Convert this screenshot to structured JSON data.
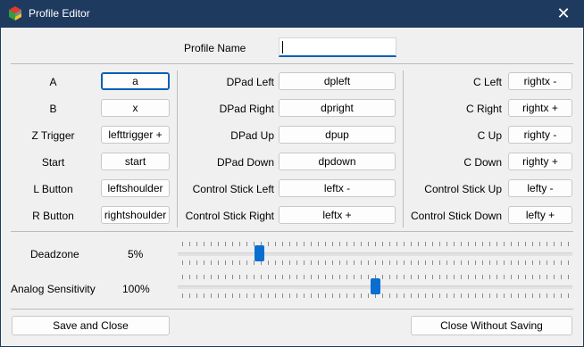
{
  "window": {
    "title": "Profile Editor"
  },
  "profile": {
    "label": "Profile Name",
    "value": ""
  },
  "col1": [
    {
      "label": "A",
      "value": "a"
    },
    {
      "label": "B",
      "value": "x"
    },
    {
      "label": "Z Trigger",
      "value": "lefttrigger +"
    },
    {
      "label": "Start",
      "value": "start"
    },
    {
      "label": "L Button",
      "value": "leftshoulder"
    },
    {
      "label": "R Button",
      "value": "rightshoulder"
    }
  ],
  "col2": [
    {
      "label": "DPad Left",
      "value": "dpleft"
    },
    {
      "label": "DPad Right",
      "value": "dpright"
    },
    {
      "label": "DPad Up",
      "value": "dpup"
    },
    {
      "label": "DPad Down",
      "value": "dpdown"
    },
    {
      "label": "Control Stick Left",
      "value": "leftx -"
    },
    {
      "label": "Control Stick Right",
      "value": "leftx +"
    }
  ],
  "col3": [
    {
      "label": "C Left",
      "value": "rightx -"
    },
    {
      "label": "C Right",
      "value": "rightx +"
    },
    {
      "label": "C Up",
      "value": "righty -"
    },
    {
      "label": "C Down",
      "value": "righty +"
    },
    {
      "label": "Control Stick Up",
      "value": "lefty -"
    },
    {
      "label": "Control Stick Down",
      "value": "lefty +"
    }
  ],
  "deadzone": {
    "label": "Deadzone",
    "value_text": "5%",
    "fraction": 0.2
  },
  "sensitivity": {
    "label": "Analog Sensitivity",
    "value_text": "100%",
    "fraction": 0.5
  },
  "buttons": {
    "save": "Save and Close",
    "close": "Close Without Saving"
  },
  "icons": {
    "app": "app-icon",
    "close": "close-icon"
  },
  "colors": {
    "titlebar": "#1f3a5f",
    "accent": "#0a6ed1"
  }
}
